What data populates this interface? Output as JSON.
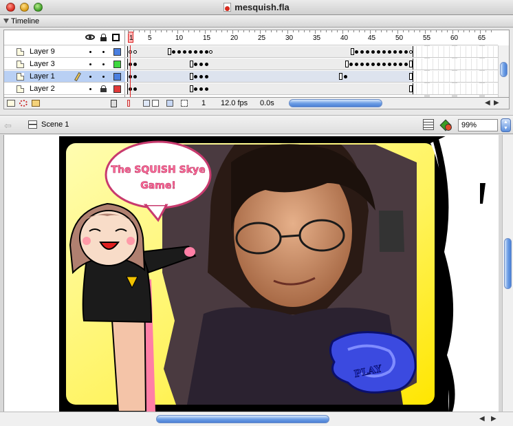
{
  "window": {
    "title": "mesquish.fla"
  },
  "timeline": {
    "label": "Timeline",
    "frame_numbers": [
      "1",
      "5",
      "10",
      "15",
      "20",
      "25",
      "30",
      "35",
      "40",
      "45",
      "50",
      "55",
      "60",
      "65"
    ],
    "layers": [
      {
        "name": "Layer 9",
        "color": "#4a7fe0"
      },
      {
        "name": "Layer 3",
        "color": "#3fd83f"
      },
      {
        "name": "Layer 1",
        "color": "#4a7fe0",
        "selected": true
      },
      {
        "name": "Layer 2",
        "color": "#e03a3a"
      }
    ],
    "status": {
      "current_frame": "1",
      "frame_rate": "12.0 fps",
      "elapsed": "0.0s"
    }
  },
  "editbar": {
    "scene": "Scene 1",
    "zoom": "99%"
  },
  "stage": {
    "bubble_line1": "The SQUISH Skye",
    "bubble_line2": "Game!",
    "play_label": "PLAY"
  },
  "colors": {
    "stage_bg": "#fff35c",
    "accent": "#4a7fd4",
    "bubble_border": "#c83a6e"
  }
}
